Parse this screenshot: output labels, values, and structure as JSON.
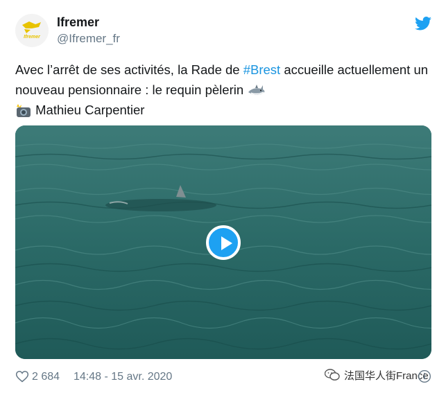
{
  "author": {
    "name": "Ifremer",
    "handle": "@Ifremer_fr",
    "avatar_icon": "ifremer-logo",
    "logo_text": "Ifremer"
  },
  "tweet": {
    "text_part1": "Avec l’arrêt de ses activités, la Rade de ",
    "hashtag": "#Brest",
    "text_part2": " accueille actuellement un nouveau pensionnaire : le requin pèlerin ",
    "shark_emoji": "shark-emoji",
    "camera_emoji": "camera-flash-emoji",
    "credit": " Mathieu Carpentier"
  },
  "media": {
    "type": "video",
    "play_icon": "play-icon"
  },
  "footer": {
    "likes": "2 684",
    "timestamp": "14:48 - 15 avr. 2020",
    "heart_icon": "heart-icon",
    "info_icon": "info-icon"
  },
  "watermark": {
    "text": "法国华人街France",
    "icon": "wechat-icon"
  },
  "colors": {
    "accent": "#1da1f2",
    "hashtag": "#1b95e0",
    "muted": "#657786",
    "brand_yellow": "#e8c300",
    "water": "#2c6a6a"
  }
}
